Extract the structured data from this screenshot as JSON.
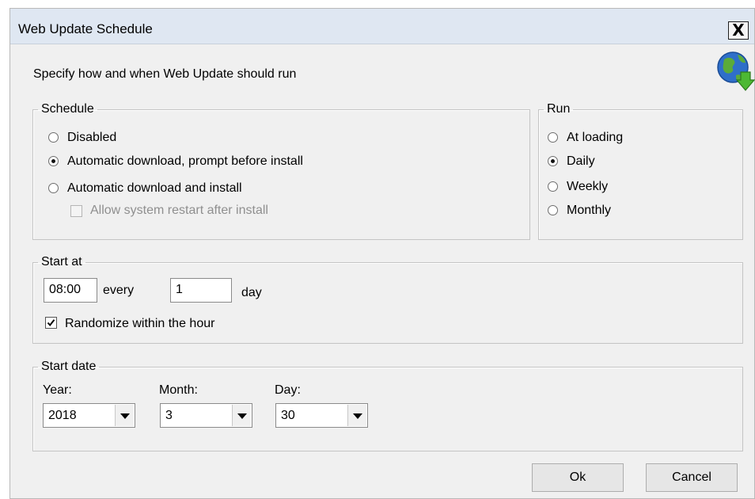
{
  "window": {
    "title": "Web Update Schedule",
    "close_label": "X"
  },
  "header": {
    "instruction": "Specify how and when Web Update should run"
  },
  "schedule": {
    "legend": "Schedule",
    "options": [
      {
        "label": "Disabled",
        "checked": false
      },
      {
        "label": "Automatic download, prompt before install",
        "checked": true
      },
      {
        "label": "Automatic download and install",
        "checked": false
      }
    ],
    "allow_restart": {
      "label": "Allow system restart after install",
      "checked": false,
      "enabled": false
    }
  },
  "run": {
    "legend": "Run",
    "options": [
      {
        "label": "At loading",
        "checked": false
      },
      {
        "label": "Daily",
        "checked": true
      },
      {
        "label": "Weekly",
        "checked": false
      },
      {
        "label": "Monthly",
        "checked": false
      }
    ]
  },
  "start_at": {
    "legend": "Start at",
    "time_value": "08:00",
    "every_label": "every",
    "interval_value": "1",
    "unit_label": "day",
    "randomize": {
      "label": "Randomize within the hour",
      "checked": true
    }
  },
  "start_date": {
    "legend": "Start date",
    "year_label": "Year:",
    "year_value": "2018",
    "month_label": "Month:",
    "month_value": "3",
    "day_label": "Day:",
    "day_value": "30"
  },
  "buttons": {
    "ok_label": "Ok",
    "cancel_label": "Cancel"
  }
}
